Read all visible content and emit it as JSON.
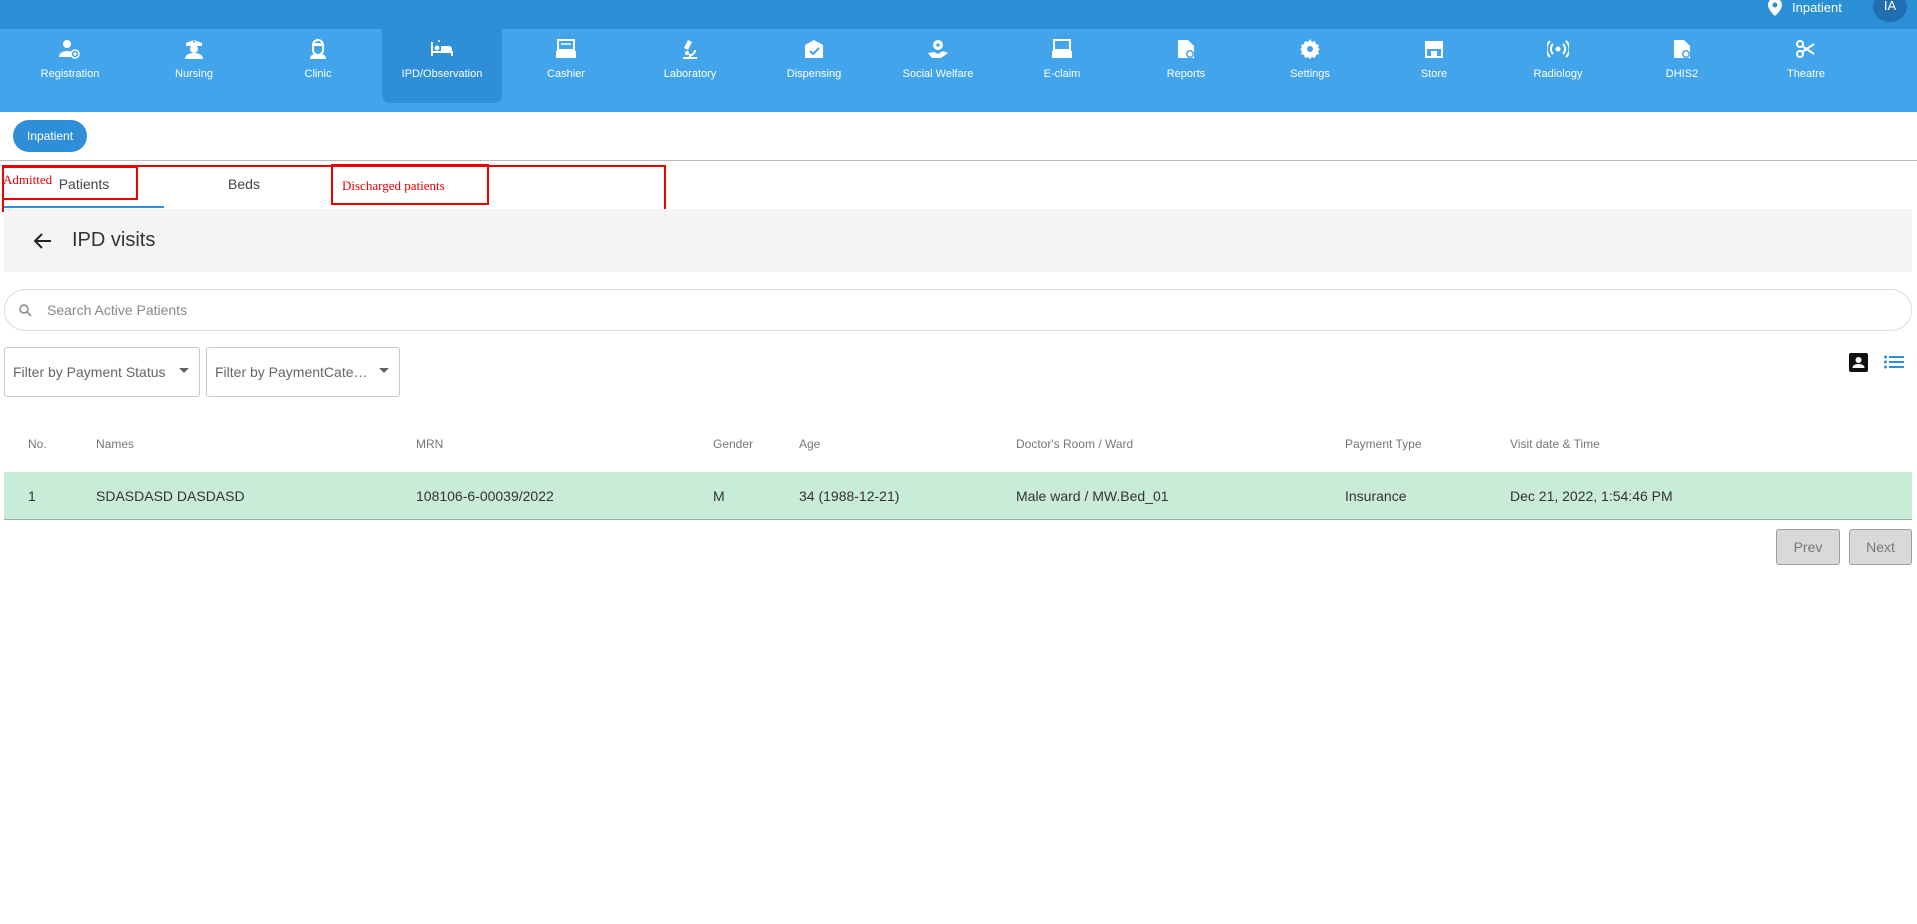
{
  "topbar": {
    "location_label": "Inpatient",
    "avatar_initials": "IA",
    "color": "#2b8fd6"
  },
  "modules": [
    {
      "label": "Registration",
      "icon": "user-add-icon"
    },
    {
      "label": "Nursing",
      "icon": "nurse-icon"
    },
    {
      "label": "Clinic",
      "icon": "doctor-icon"
    },
    {
      "label": "IPD/Observation",
      "icon": "hospital-bed-icon",
      "active": true
    },
    {
      "label": "Cashier",
      "icon": "cash-register-icon"
    },
    {
      "label": "Laboratory",
      "icon": "microscope-icon"
    },
    {
      "label": "Dispensing",
      "icon": "pharmacy-icon"
    },
    {
      "label": "Social Welfare",
      "icon": "hand-heart-icon"
    },
    {
      "label": "E-claim",
      "icon": "register-icon"
    },
    {
      "label": "Reports",
      "icon": "report-icon"
    },
    {
      "label": "Settings",
      "icon": "gear-icon"
    },
    {
      "label": "Store",
      "icon": "store-icon"
    },
    {
      "label": "Radiology",
      "icon": "radiation-icon"
    },
    {
      "label": "DHIS2",
      "icon": "document-icon"
    },
    {
      "label": "Theatre",
      "icon": "scissors-icon"
    }
  ],
  "sub_chip": "Inpatient",
  "tabs": [
    {
      "label": "Patients",
      "active": true
    },
    {
      "label": "Beds"
    }
  ],
  "annotations": {
    "admitted": "Admitted",
    "discharged": "Discharged patients",
    "color": "#ee0000"
  },
  "page": {
    "title": "IPD visits"
  },
  "search": {
    "placeholder": "Search Active Patients",
    "value": ""
  },
  "filters": {
    "payment_status": "Filter by Payment Status",
    "payment_category": "Filter by PaymentCateg..."
  },
  "table": {
    "columns": [
      "No.",
      "Names",
      "MRN",
      "Gender",
      "Age",
      "Doctor's Room / Ward",
      "Payment Type",
      "Visit date & Time"
    ],
    "rows": [
      [
        "1",
        "SDASDASD DASDASD",
        "108106-6-00039/2022",
        "M",
        "34 (1988-12-21)",
        "Male ward / MW.Bed_01",
        "Insurance",
        "Dec 21, 2022, 1:54:46 PM"
      ]
    ],
    "row_color": "#c8ecd7"
  },
  "pagination": {
    "prev": "Prev",
    "next": "Next"
  }
}
